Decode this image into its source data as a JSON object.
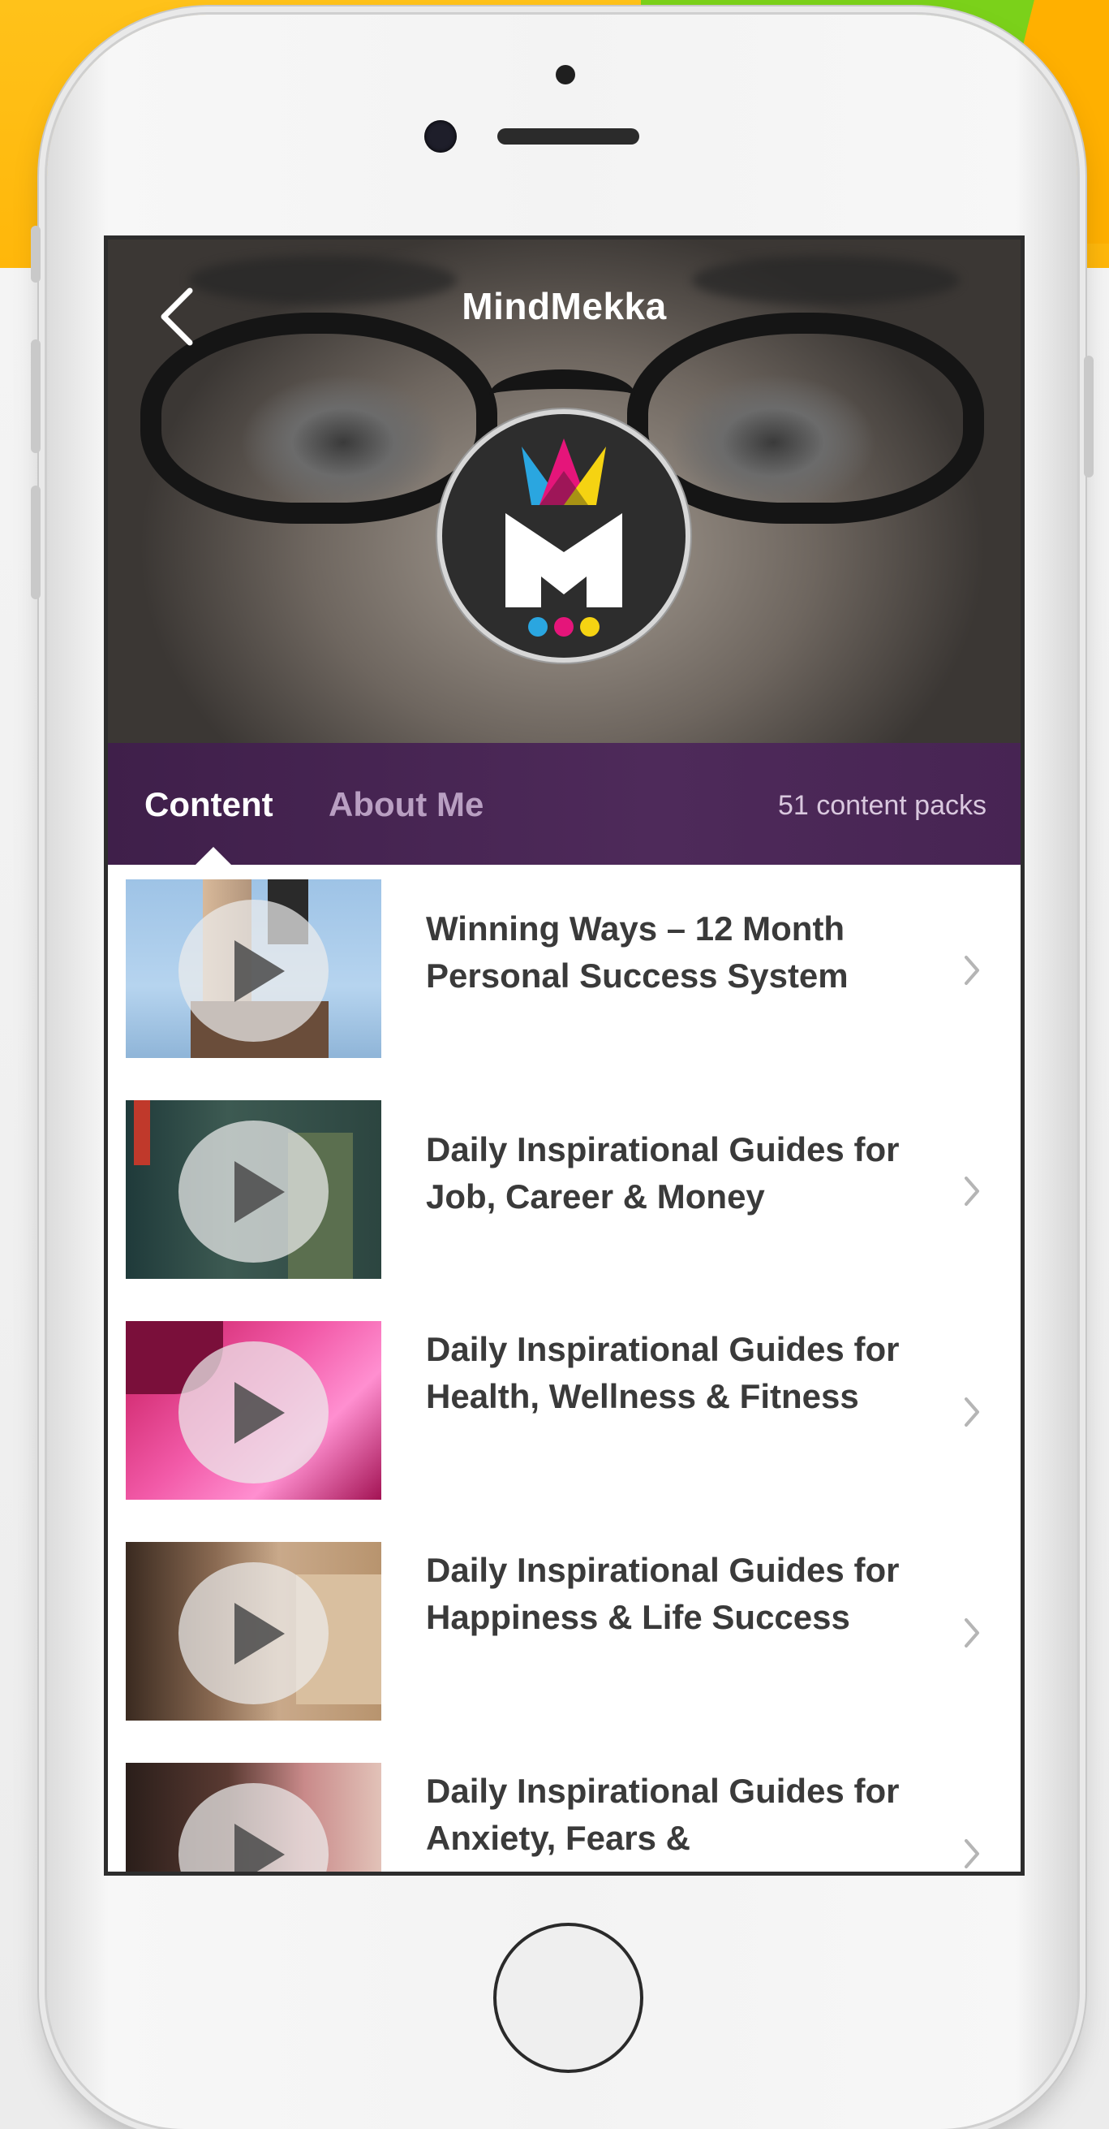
{
  "app": {
    "title": "MindMekka"
  },
  "tabs": {
    "content_label": "Content",
    "about_label": "About Me",
    "active": "Content",
    "pack_count": "51 content packs"
  },
  "icons": {
    "back": "chevron-left-icon",
    "row": "chevron-right-icon",
    "play": "play-icon"
  },
  "colors": {
    "tabbar": "#4a2656",
    "tab_inactive": "#b99fc2",
    "row_text": "#3a3a3a",
    "background_yellow": "#ffb70a",
    "background_green": "#7bd11a"
  },
  "content_packs": [
    {
      "title": "Winning Ways – 12 Month Personal Success System"
    },
    {
      "title": "Daily Inspirational Guides for Job, Career & Money"
    },
    {
      "title": "Daily Inspirational Guides for Health, Wellness & Fitness"
    },
    {
      "title": "Daily Inspirational Guides for Happiness & Life Success"
    },
    {
      "title": "Daily Inspirational Guides for Anxiety, Fears &"
    }
  ]
}
